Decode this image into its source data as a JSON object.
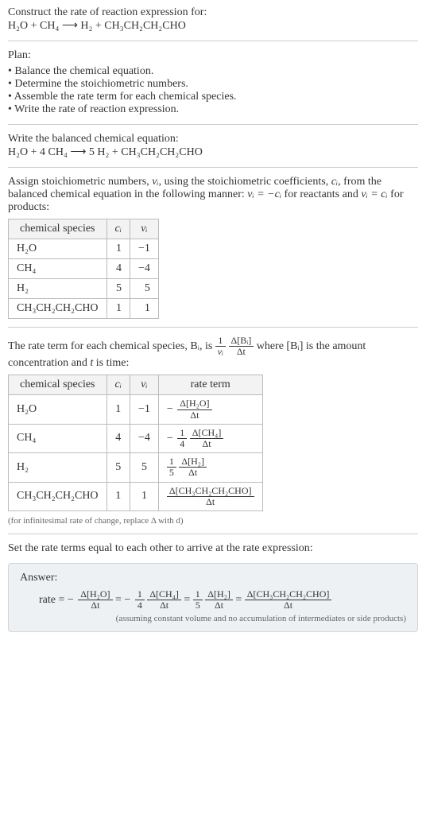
{
  "header": {
    "prompt": "Construct the rate of reaction expression for:",
    "equation_unbalanced": "H₂O + CH₄ ⟶ H₂ + CH₃CH₂CH₂CHO"
  },
  "plan": {
    "title": "Plan:",
    "steps": [
      "Balance the chemical equation.",
      "Determine the stoichiometric numbers.",
      "Assemble the rate term for each chemical species.",
      "Write the rate of reaction expression."
    ]
  },
  "balanced": {
    "instruction": "Write the balanced chemical equation:",
    "equation": "H₂O + 4 CH₄ ⟶ 5 H₂ + CH₃CH₂CH₂CHO"
  },
  "stoich": {
    "intro_pre": "Assign stoichiometric numbers, ",
    "intro_mid1": ", using the stoichiometric coefficients, ",
    "intro_mid2": ", from the balanced chemical equation in the following manner: ",
    "intro_mid3": " for reactants and ",
    "intro_end": " for products:",
    "nu_sym": "νᵢ",
    "c_sym": "cᵢ",
    "rel_react": "νᵢ = −cᵢ",
    "rel_prod": "νᵢ = cᵢ",
    "headers": {
      "species": "chemical species",
      "c": "cᵢ",
      "nu": "νᵢ"
    },
    "rows": [
      {
        "species": "H₂O",
        "c": "1",
        "nu": "−1"
      },
      {
        "species": "CH₄",
        "c": "4",
        "nu": "−4"
      },
      {
        "species": "H₂",
        "c": "5",
        "nu": "5"
      },
      {
        "species": "CH₃CH₂CH₂CHO",
        "c": "1",
        "nu": "1"
      }
    ]
  },
  "rate_intro": {
    "pre": "The rate term for each chemical species, Bᵢ, is ",
    "frac1_num": "1",
    "frac1_den": "νᵢ",
    "frac2_num": "Δ[Bᵢ]",
    "frac2_den": "Δt",
    "mid": " where [Bᵢ] is the amount concentration and ",
    "tvar": "t",
    "end": " is time:"
  },
  "rate_table": {
    "headers": {
      "species": "chemical species",
      "c": "cᵢ",
      "nu": "νᵢ",
      "rate": "rate term"
    },
    "rows": [
      {
        "species": "H₂O",
        "c": "1",
        "nu": "−1",
        "sign": "−",
        "coef_num": "",
        "coef_den": "",
        "d_num": "Δ[H₂O]",
        "d_den": "Δt"
      },
      {
        "species": "CH₄",
        "c": "4",
        "nu": "−4",
        "sign": "−",
        "coef_num": "1",
        "coef_den": "4",
        "d_num": "Δ[CH₄]",
        "d_den": "Δt"
      },
      {
        "species": "H₂",
        "c": "5",
        "nu": "5",
        "sign": "",
        "coef_num": "1",
        "coef_den": "5",
        "d_num": "Δ[H₂]",
        "d_den": "Δt"
      },
      {
        "species": "CH₃CH₂CH₂CHO",
        "c": "1",
        "nu": "1",
        "sign": "",
        "coef_num": "",
        "coef_den": "",
        "d_num": "Δ[CH₃CH₂CH₂CHO]",
        "d_den": "Δt"
      }
    ],
    "footnote": "(for infinitesimal rate of change, replace Δ with d)"
  },
  "final": {
    "intro": "Set the rate terms equal to each other to arrive at the rate expression:",
    "answer_label": "Answer:",
    "rate_label": "rate = ",
    "terms": [
      {
        "sign": "−",
        "coef_num": "",
        "coef_den": "",
        "d_num": "Δ[H₂O]",
        "d_den": "Δt"
      },
      {
        "sign": "−",
        "coef_num": "1",
        "coef_den": "4",
        "d_num": "Δ[CH₄]",
        "d_den": "Δt"
      },
      {
        "sign": "",
        "coef_num": "1",
        "coef_den": "5",
        "d_num": "Δ[H₂]",
        "d_den": "Δt"
      },
      {
        "sign": "",
        "coef_num": "",
        "coef_den": "",
        "d_num": "Δ[CH₃CH₂CH₂CHO]",
        "d_den": "Δt"
      }
    ],
    "eq": " = ",
    "note": "(assuming constant volume and no accumulation of intermediates or side products)"
  }
}
